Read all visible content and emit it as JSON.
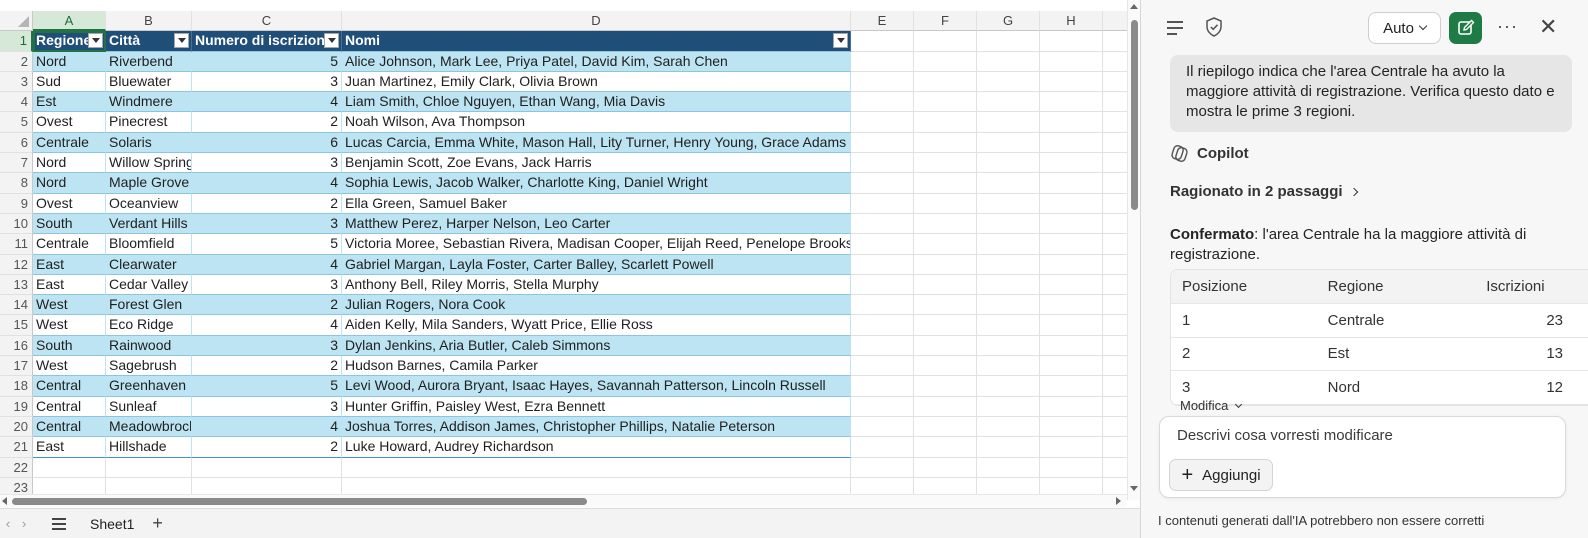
{
  "spreadsheet": {
    "columns": [
      "A",
      "B",
      "C",
      "D",
      "E",
      "F",
      "G",
      "H"
    ],
    "selected_column": "A",
    "table_headers": [
      "Regione",
      "Città",
      "Numero di iscrizioni",
      "Nomi"
    ],
    "rows": [
      {
        "n": "2",
        "region": "Nord",
        "city": "Riverbend",
        "count": "5",
        "names": "Alice Johnson, Mark Lee, Priya Patel, David Kim, Sarah Chen"
      },
      {
        "n": "3",
        "region": "Sud",
        "city": "Bluewater",
        "count": "3",
        "names": "Juan Martinez, Emily Clark, Olivia Brown"
      },
      {
        "n": "4",
        "region": "Est",
        "city": "Windmere",
        "count": "4",
        "names": "Liam Smith, Chloe Nguyen, Ethan Wang, Mia Davis"
      },
      {
        "n": "5",
        "region": "Ovest",
        "city": "Pinecrest",
        "count": "2",
        "names": "Noah Wilson, Ava Thompson"
      },
      {
        "n": "6",
        "region": "Centrale",
        "city": "Solaris",
        "count": "6",
        "names": "Lucas Carcia, Emma White, Mason Hall, Lity Turner, Henry Young, Grace Adams"
      },
      {
        "n": "7",
        "region": "Nord",
        "city": "Willow Spring",
        "count": "3",
        "names": "Benjamin Scott, Zoe Evans, Jack Harris"
      },
      {
        "n": "8",
        "region": "Nord",
        "city": "Maple Grove",
        "count": "4",
        "names": "Sophia Lewis, Jacob Walker, Charlotte King, Daniel Wright"
      },
      {
        "n": "9",
        "region": "Ovest",
        "city": "Oceanview",
        "count": "2",
        "names": "Ella Green, Samuel Baker"
      },
      {
        "n": "10",
        "region": "South",
        "city": "Verdant Hills",
        "count": "3",
        "names": "Matthew Perez, Harper Nelson, Leo Carter"
      },
      {
        "n": "11",
        "region": "Centrale",
        "city": "Bloomfield",
        "count": "5",
        "names": "Victoria Moree, Sebastian Rivera, Madisan Cooper, Elijah Reed, Penelope Brooks"
      },
      {
        "n": "12",
        "region": "East",
        "city": "Clearwater",
        "count": "4",
        "names": "Gabriel Margan, Layla Foster, Carter Balley, Scarlett Powell"
      },
      {
        "n": "13",
        "region": "East",
        "city": "Cedar Valley",
        "count": "3",
        "names": "Anthony Bell, Riley Morris, Stella Murphy"
      },
      {
        "n": "14",
        "region": "West",
        "city": "Forest Glen",
        "count": "2",
        "names": "Julian Rogers, Nora Cook"
      },
      {
        "n": "15",
        "region": "West",
        "city": "Eco Ridge",
        "count": "4",
        "names": "Aiden Kelly, Mila Sanders, Wyatt Price, Ellie Ross"
      },
      {
        "n": "16",
        "region": "South",
        "city": "Rainwood",
        "count": "3",
        "names": "Dylan Jenkins, Aria Butler, Caleb Simmons"
      },
      {
        "n": "17",
        "region": "West",
        "city": "Sagebrush",
        "count": "2",
        "names": "Hudson Barnes, Camila Parker"
      },
      {
        "n": "18",
        "region": "Central",
        "city": "Greenhaven",
        "count": "5",
        "names": "Levi Wood, Aurora Bryant, Isaac Hayes, Savannah Patterson, Lincoln Russell"
      },
      {
        "n": "19",
        "region": "Central",
        "city": "Sunleaf",
        "count": "3",
        "names": "Hunter Griffin, Paisley West, Ezra Bennett"
      },
      {
        "n": "20",
        "region": "Central",
        "city": "Meadowbrock",
        "count": "4",
        "names": "Joshua Torres, Addison James, Christopher Phillips, Natalie Peterson"
      },
      {
        "n": "21",
        "region": "East",
        "city": "Hillshade",
        "count": "2",
        "names": "Luke Howard, Audrey Richardson"
      }
    ],
    "empty_rows": [
      "22",
      "23"
    ],
    "sheet_tab": "Sheet1",
    "nav_prev": "‹",
    "nav_next": "›",
    "add_sheet": "+"
  },
  "copilot": {
    "mode_label": "Auto",
    "more": "···",
    "close": "✕",
    "user_message": "Il riepilogo indica che l'area Centrale ha avuto la maggiore attività di registrazione. Verifica questo dato e mostra le prime 3 regioni.",
    "assistant_name": "Copilot",
    "reasoning": "Ragionato in 2 passaggi",
    "confirm_label": "Confermato",
    "confirm_text": ": l'area Centrale ha la maggiore attività di registrazione.",
    "table_headers": [
      "Posizione",
      "Regione",
      "Iscrizioni"
    ],
    "table_rows": [
      {
        "pos": "1",
        "region": "Centrale",
        "count": "23"
      },
      {
        "pos": "2",
        "region": "Est",
        "count": "13"
      },
      {
        "pos": "3",
        "region": "Nord",
        "count": "12"
      }
    ],
    "modify_label": "Modifica",
    "composer_placeholder": "Descrivi cosa vorresti modificare",
    "add_button": "Aggiungi",
    "disclaimer": "I contenuti generati dall'IA potrebbero non essere corretti"
  },
  "colors": {
    "header_fill": "#1f4e79",
    "band_fill": "#bde4f2",
    "accent_green": "#1e7b45"
  }
}
